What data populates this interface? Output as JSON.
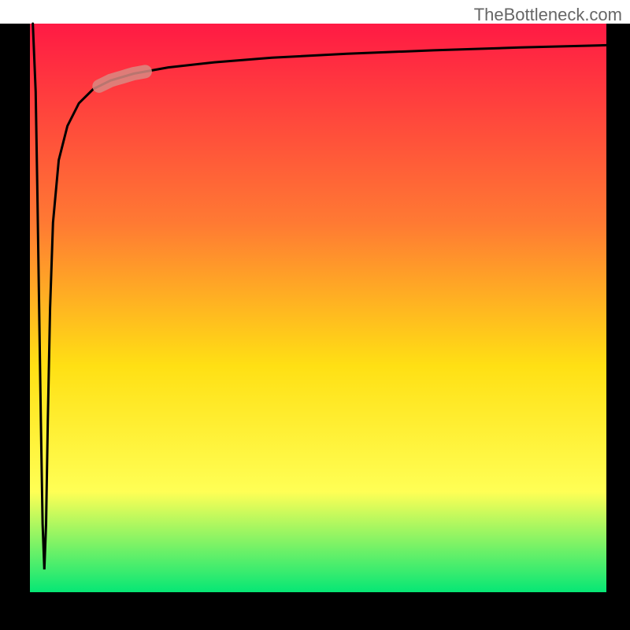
{
  "watermark": "TheBottleneck.com",
  "chart_data": {
    "type": "line",
    "title": "",
    "xlabel": "",
    "ylabel": "",
    "xlim": [
      0,
      100
    ],
    "ylim": [
      0,
      100
    ],
    "background_gradient": {
      "top_color": "#ff1a44",
      "mid_top_color": "#ff7a33",
      "mid_color": "#ffe014",
      "mid_bottom_color": "#ffff55",
      "bottom_color": "#00e676"
    },
    "curve": {
      "description": "Curve descends from top-left frame corner nearly vertically to the bottom-left region, then rises steeply along the left edge forming a narrow notch, then sweeps up and right asymptotically toward the top-right frame corner.",
      "points": [
        {
          "x": 0.5,
          "y": 100
        },
        {
          "x": 1.0,
          "y": 88
        },
        {
          "x": 1.3,
          "y": 70
        },
        {
          "x": 1.6,
          "y": 50
        },
        {
          "x": 1.9,
          "y": 30
        },
        {
          "x": 2.2,
          "y": 12
        },
        {
          "x": 2.5,
          "y": 4
        },
        {
          "x": 2.8,
          "y": 12
        },
        {
          "x": 3.1,
          "y": 30
        },
        {
          "x": 3.5,
          "y": 50
        },
        {
          "x": 4.0,
          "y": 65
        },
        {
          "x": 5.0,
          "y": 76
        },
        {
          "x": 6.5,
          "y": 82
        },
        {
          "x": 8.5,
          "y": 86
        },
        {
          "x": 11,
          "y": 88.5
        },
        {
          "x": 14,
          "y": 90
        },
        {
          "x": 18,
          "y": 91.2
        },
        {
          "x": 24,
          "y": 92.3
        },
        {
          "x": 32,
          "y": 93.2
        },
        {
          "x": 42,
          "y": 94.0
        },
        {
          "x": 55,
          "y": 94.7
        },
        {
          "x": 70,
          "y": 95.3
        },
        {
          "x": 85,
          "y": 95.8
        },
        {
          "x": 100,
          "y": 96.2
        }
      ]
    },
    "highlight_segment": {
      "description": "Short translucent pale-red capsule overlay resting on the curve near the upper-left bend.",
      "x_start": 12,
      "x_end": 20,
      "color": "#d98a83",
      "opacity": 0.85
    }
  }
}
